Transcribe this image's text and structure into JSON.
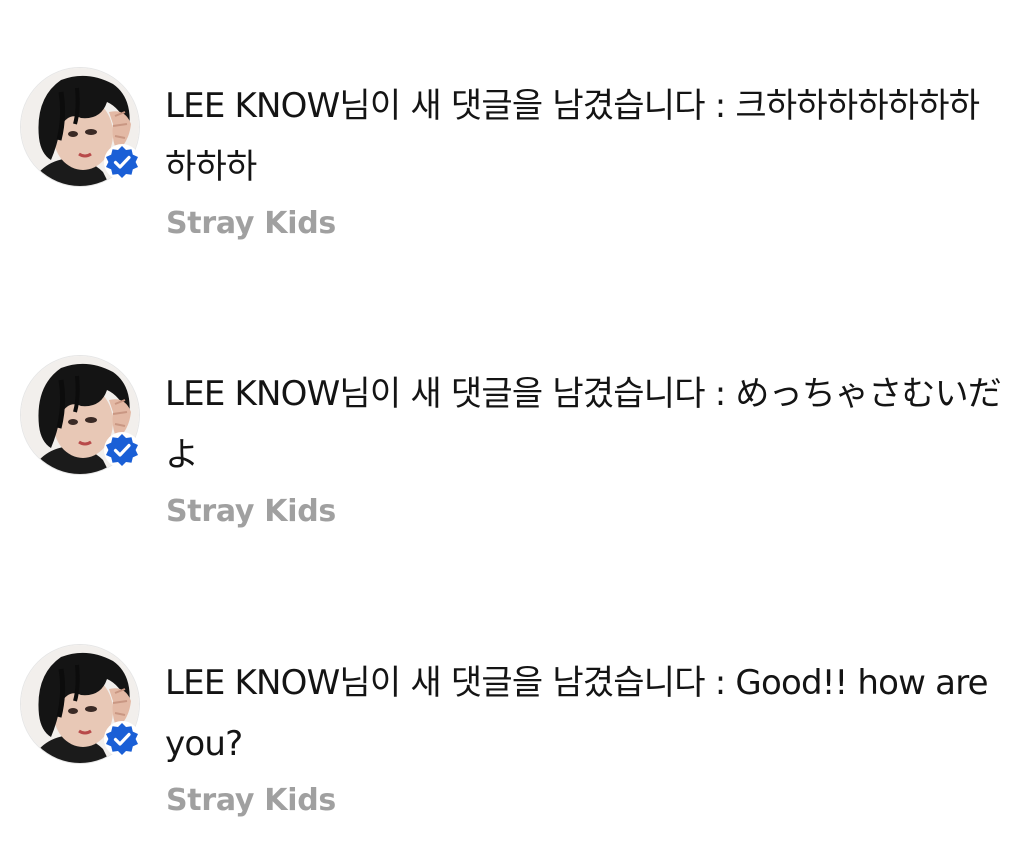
{
  "notifications": [
    {
      "message": "LEE KNOW님이 새 댓글을 남겼습니다 : 크하하하하하하하하하하",
      "source": "Stray Kids",
      "verified": true
    },
    {
      "message": "LEE KNOW님이 새 댓글을 남겼습니다 : めっちゃさむいだよ",
      "source": "Stray Kids",
      "verified": true
    },
    {
      "message": "LEE KNOW님이 새 댓글을 남겼습니다 : Good!! how are you?",
      "source": "Stray Kids",
      "verified": true
    }
  ],
  "colors": {
    "verified_badge": "#1a5fd6",
    "source_text": "#a0a0a0",
    "message_text": "#141414"
  },
  "icons": {
    "avatar": "profile-photo",
    "badge": "verified-badge-icon"
  }
}
